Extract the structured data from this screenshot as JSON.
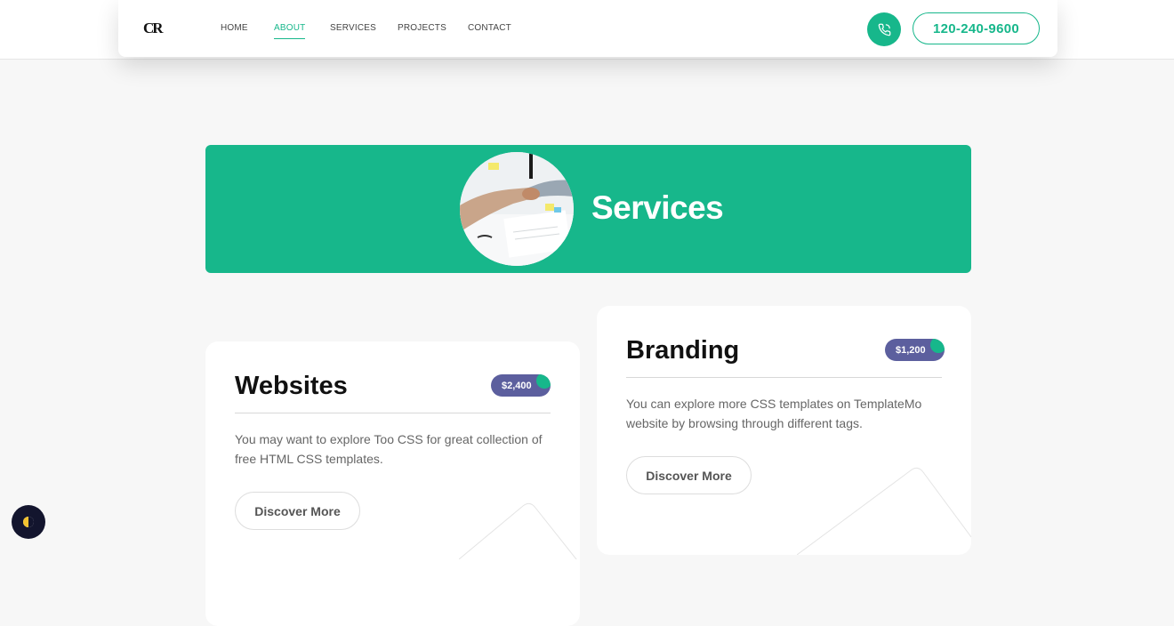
{
  "header": {
    "logo": "CR",
    "nav": [
      {
        "label": "HOME",
        "active": false
      },
      {
        "label": "ABOUT",
        "active": true
      },
      {
        "label": "SERVICES",
        "active": false
      },
      {
        "label": "PROJECTS",
        "active": false
      },
      {
        "label": "CONTACT",
        "active": false
      }
    ],
    "phone_icon": "phone-icon",
    "phone_number": "120-240-9600"
  },
  "hero": {
    "title": "Services",
    "image": "handshake-photo"
  },
  "cards": [
    {
      "title": "Websites",
      "price": "$2,400",
      "description": "You may want to explore Too CSS for great collection of free HTML CSS templates.",
      "button_label": "Discover More"
    },
    {
      "title": "Branding",
      "price": "$1,200",
      "description": "You can explore more CSS templates on TemplateMo website by browsing through different tags.",
      "button_label": "Discover More"
    }
  ],
  "theme_toggle_icon": "half-moon-icon",
  "colors": {
    "accent": "#17b78b",
    "price_badge": "#5c5f9e",
    "toggle_bg": "#13152e"
  }
}
